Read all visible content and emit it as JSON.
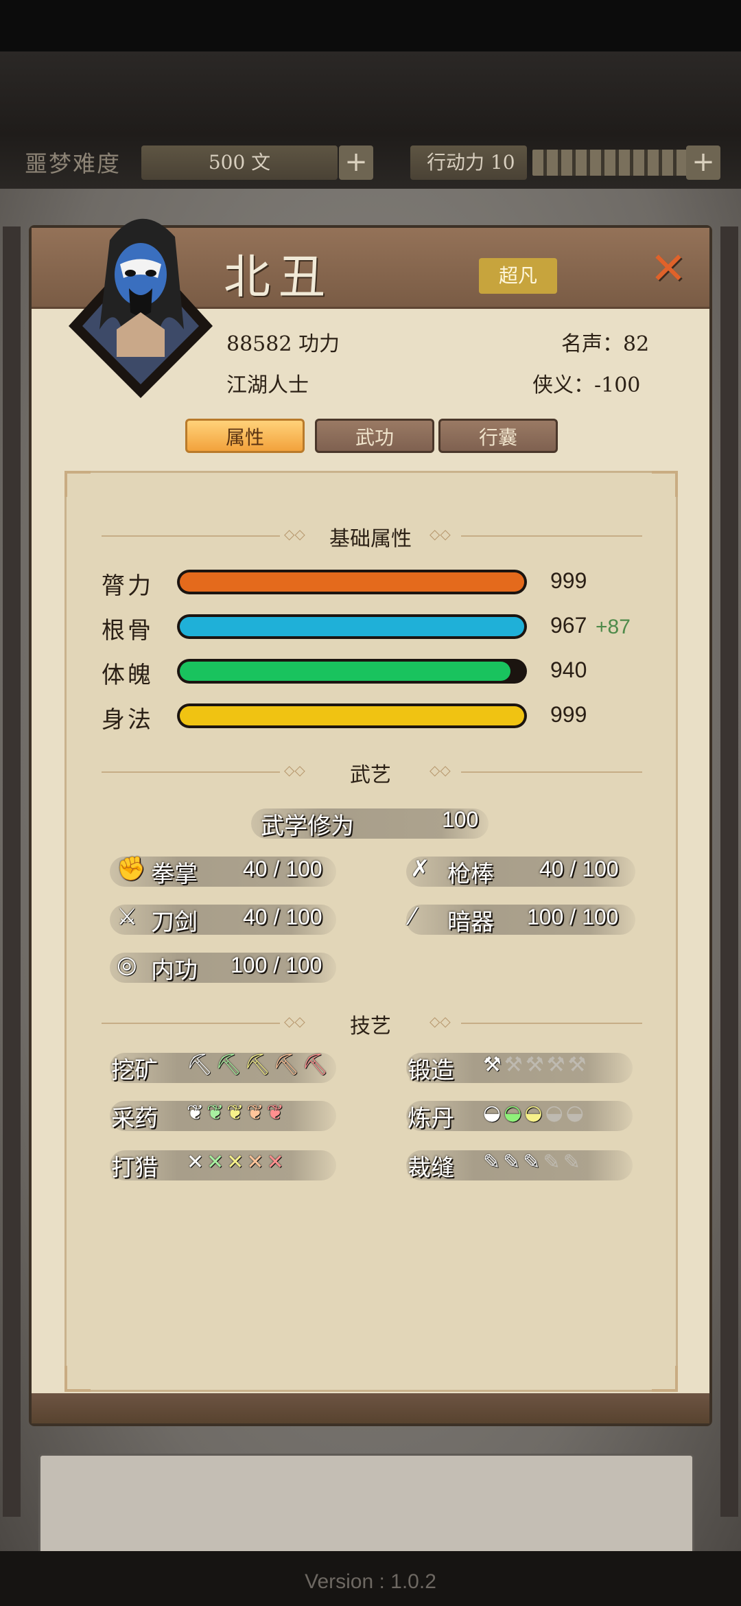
{
  "topbar": {
    "difficulty_label": "噩梦难度",
    "currency_value": "500 文",
    "action_points_label": "行动力 10",
    "plus_icon": "plus-icon"
  },
  "character": {
    "name": "北丑",
    "rank": "超凡",
    "power": "88582 功力",
    "identity": "江湖人士",
    "fame": "名声：82",
    "chivalry": "侠义：-100"
  },
  "tabs": [
    {
      "label": "属性",
      "active": true
    },
    {
      "label": "武功",
      "active": false
    },
    {
      "label": "行囊",
      "active": false
    }
  ],
  "sections": {
    "basic": "基础属性",
    "martial": "武艺",
    "crafts": "技艺"
  },
  "attributes": [
    {
      "label": "膂力",
      "value": "999",
      "bonus": "",
      "fill": 1.0,
      "color": "#e46a1c"
    },
    {
      "label": "根骨",
      "value": "967",
      "bonus": "+87",
      "fill": 1.0,
      "color": "#1fb0d8"
    },
    {
      "label": "体魄",
      "value": "940",
      "bonus": "",
      "fill": 0.96,
      "color": "#19c35e"
    },
    {
      "label": "身法",
      "value": "999",
      "bonus": "",
      "fill": 1.0,
      "color": "#f0c312"
    }
  ],
  "martial": {
    "cultivation_label": "武学修为",
    "cultivation_value": "100",
    "skills": [
      {
        "name": "拳掌",
        "value": "40 / 100",
        "icon": "fist-icon"
      },
      {
        "name": "枪棒",
        "value": "40 / 100",
        "icon": "spear-icon"
      },
      {
        "name": "刀剑",
        "value": "40 / 100",
        "icon": "sword-icon"
      },
      {
        "name": "暗器",
        "value": "100 / 100",
        "icon": "dart-icon"
      },
      {
        "name": "内功",
        "value": "100 / 100",
        "icon": "inner-power-icon"
      }
    ]
  },
  "crafts": [
    {
      "name": "挖矿",
      "icon": "pickaxe-icon",
      "level": 5,
      "max": 5,
      "colors": [
        "#ffffff",
        "#a8f0a0",
        "#f6f08a",
        "#ffc49a",
        "#ff8f8f"
      ]
    },
    {
      "name": "锻造",
      "icon": "anvil-icon",
      "level": 1,
      "max": 5,
      "colors": [
        "#ffffff"
      ]
    },
    {
      "name": "采药",
      "icon": "herb-icon",
      "level": 5,
      "max": 5,
      "colors": [
        "#ffffff",
        "#a8f0a0",
        "#f6f08a",
        "#ffc49a",
        "#ff8f8f"
      ]
    },
    {
      "name": "炼丹",
      "icon": "mortar-icon",
      "level": 3,
      "max": 5,
      "colors": [
        "#ffffff",
        "#8ff07a",
        "#f6f08a"
      ]
    },
    {
      "name": "打猎",
      "icon": "bow-icon",
      "level": 5,
      "max": 5,
      "colors": [
        "#ffffff",
        "#a8f0a0",
        "#f6f08a",
        "#ffc49a",
        "#ff8f8f"
      ]
    },
    {
      "name": "裁缝",
      "icon": "needle-icon",
      "level": 3,
      "max": 5,
      "colors": [
        "#ffffff",
        "#ffffff",
        "#ffffff"
      ]
    }
  ],
  "footer": {
    "version": "Version : 1.0.2"
  }
}
